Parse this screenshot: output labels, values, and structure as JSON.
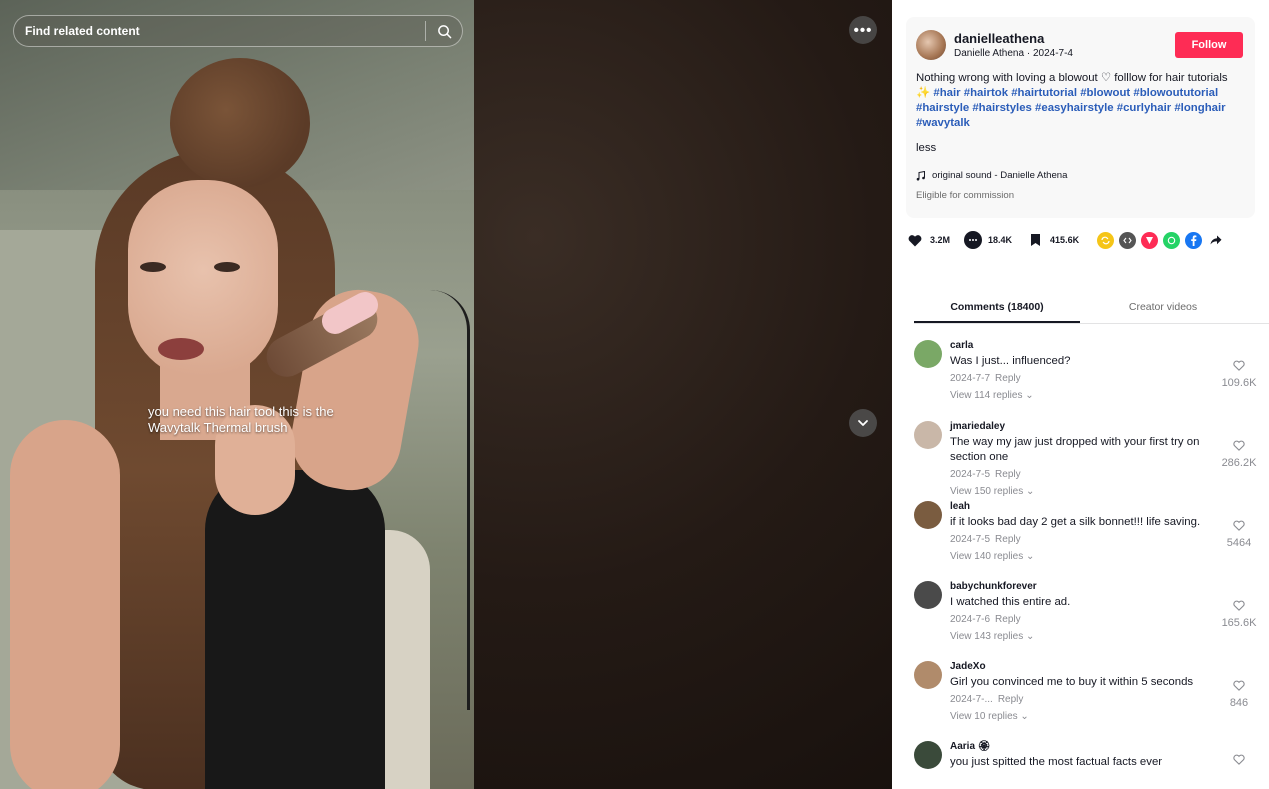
{
  "video": {
    "search_placeholder": "Find related content",
    "caption": "you need this hair tool this is the Wavytalk Thermal brush",
    "more_label": "•••"
  },
  "post": {
    "username": "danielleathena",
    "display_name": "Danielle Athena",
    "date": "2024-7-4",
    "follow_label": "Follow",
    "desc_text": "Nothing wrong with loving a blowout ♡ folllow for hair tutorials ✨ ",
    "hashtags": "#hair #hairtok #hairtutorial #blowout #blowoututorial #hairstyle #hairstyles #easyhairstyle #curlyhair #longhair #wavytalk",
    "less_label": "less",
    "music": "original sound - Danielle Athena",
    "commission": "Eligible for commission"
  },
  "stats": {
    "likes": "3.2M",
    "comments": "18.4K",
    "saves": "415.6K"
  },
  "share_icons": [
    {
      "name": "repost-icon",
      "color": "#f5c518"
    },
    {
      "name": "embed-icon",
      "color": "#555555"
    },
    {
      "name": "send-icon",
      "color": "#fe2c55"
    },
    {
      "name": "whatsapp-icon",
      "color": "#25d366"
    },
    {
      "name": "facebook-icon",
      "color": "#1877f2"
    },
    {
      "name": "share-arrow-icon",
      "color": "#161823"
    }
  ],
  "tabs": {
    "comments": "Comments (18400)",
    "creator_videos": "Creator videos"
  },
  "comments": [
    {
      "user": "carla",
      "text": "Was I just... influenced?",
      "date": "2024-7-7",
      "reply": "Reply",
      "views": "View 114 replies",
      "likes": "109.6K",
      "avatar_color": "#7aa866"
    },
    {
      "user": "jmariedaley",
      "text": "The way my jaw just dropped with your first try on section one",
      "date": "2024-7-5",
      "reply": "Reply",
      "views": "View 150 replies",
      "likes": "286.2K",
      "avatar_color": "#c9b7a8"
    },
    {
      "user": "leah",
      "text": "if it looks bad day 2 get a silk bonnet!!! life saving.",
      "date": "2024-7-5",
      "reply": "Reply",
      "views": "View 140 replies",
      "likes": "5464",
      "avatar_color": "#7a5c40"
    },
    {
      "user": "babychunkforever",
      "text": "I watched this entire ad.",
      "date": "2024-7-6",
      "reply": "Reply",
      "views": "View 143 replies",
      "likes": "165.6K",
      "avatar_color": "#4a4a4a"
    },
    {
      "user": "JadeXo",
      "text": "Girl you convinced me to buy it within 5 seconds",
      "date": "2024-7-...",
      "reply": "Reply",
      "views": "View 10 replies",
      "likes": "846",
      "avatar_color": "#b08b6b"
    },
    {
      "user": "Aaria 🏵",
      "text": "you just spitted the most factual facts ever",
      "date": "",
      "reply": "",
      "views": "",
      "likes": "",
      "avatar_color": "#3a4a3a"
    }
  ]
}
